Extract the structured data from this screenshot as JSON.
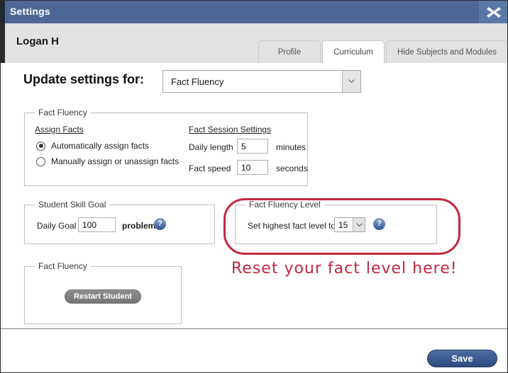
{
  "window": {
    "title": "Settings",
    "close_icon": "close-x-icon"
  },
  "header": {
    "student_name": "Logan H",
    "tabs": [
      {
        "label": "Profile",
        "active": false
      },
      {
        "label": "Curriculum",
        "active": true
      },
      {
        "label": "Hide Subjects and Modules",
        "active": false
      }
    ]
  },
  "main": {
    "update_label": "Update settings for:",
    "subject_select": {
      "value": "Fact Fluency",
      "chevron_icon": "chevron-down-icon"
    },
    "fact_fluency": {
      "legend": "Fact Fluency",
      "assign_heading": "Assign Facts",
      "radio_options": [
        {
          "label": "Automatically assign facts",
          "checked": true
        },
        {
          "label": "Manually assign or unassign facts",
          "checked": false
        }
      ],
      "session_heading": "Fact Session Settings",
      "daily_length_label": "Daily length",
      "daily_length_value": "5",
      "daily_length_unit": "minutes",
      "fact_speed_label": "Fact speed",
      "fact_speed_value": "10",
      "fact_speed_unit": "seconds"
    },
    "skill_goal": {
      "legend": "Student Skill Goal",
      "daily_goal_label": "Daily Goal",
      "daily_goal_value": "100",
      "daily_goal_unit": "problems",
      "help_icon": "question-mark-icon"
    },
    "fact_level": {
      "legend": "Fact Fluency Level",
      "set_level_label": "Set highest fact level to",
      "level_value": "15",
      "chevron_icon": "chevron-down-icon",
      "help_icon": "question-mark-icon"
    },
    "restart": {
      "legend": "Fact Fluency",
      "button_label": "Restart Student"
    },
    "annotation": {
      "text": "Reset your fact level here!",
      "color": "#c0293f"
    }
  },
  "footer": {
    "save_label": "Save"
  },
  "colors": {
    "titlebar": "#4c6795",
    "close_button": "#5a78a6",
    "header_band": "#e2e2e2",
    "accent_red": "#c0293f",
    "save_button": "#2c4a7c",
    "help_icon": "#2c5593"
  }
}
